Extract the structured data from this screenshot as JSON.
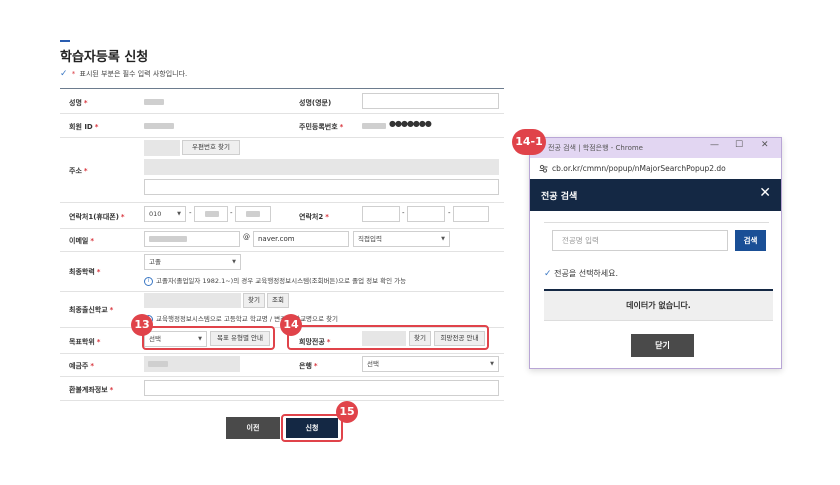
{
  "page": {
    "title": "학습자등록 신청",
    "required_note_prefix": "✓",
    "required_note_star": "*",
    "required_note": "표시된 부분은 필수 입력 사항입니다."
  },
  "form": {
    "name_label": "성명",
    "name_en_label": "성명(영문)",
    "member_id_label": "회원 ID",
    "rrn_label": "주민등록번호",
    "rrn_masked": "●●●●●●●",
    "address_label": "주소",
    "zip_button": "우편번호 찾기",
    "phone1_label": "연락처1(휴대폰)",
    "phone1_prefix": "010",
    "phone2_label": "연락처2",
    "email_label": "이메일",
    "email_at": "@",
    "email_domain": "naver.com",
    "email_direct": "직접입력",
    "education_label": "최종학력",
    "education_value": "고졸",
    "education_info": "고졸자(졸업일자 1982.1~)의 경우 교육행정정보시스템(조회버튼)으로 졸업 정보 확인 가능",
    "school_label": "최종출신학교",
    "school_find": "찾기",
    "school_lookup": "조회",
    "school_info": "교육행정정보시스템으로 고등학교 학교명 / 변경된 학교명으로 찾기",
    "degree_label": "목표학위",
    "degree_select": "선택",
    "degree_guide_button": "목표 유형별 안내",
    "major_label": "희망전공",
    "major_find": "찾기",
    "major_guide_button": "희망전공 안내",
    "depositor_label": "예금주",
    "bank_label": "은행",
    "bank_select": "선택",
    "refund_label": "환불계좌정보",
    "required_star": "*"
  },
  "actions": {
    "prev": "이전",
    "submit": "신청"
  },
  "badges": {
    "b13": "13",
    "b14": "14",
    "b15": "15",
    "b14_1": "14-1"
  },
  "popup": {
    "window_title": "전공 검색 | 학점은행 - Chrome",
    "url": "cb.or.kr/cmmn/popup/nMajorSearchPopup2.do",
    "header": "전공 검색",
    "search_placeholder": "전공명 입력",
    "search_button": "검색",
    "select_prompt": "전공을 선택하세요.",
    "empty_message": "데이터가 없습니다.",
    "close_button": "닫기"
  },
  "colors": {
    "accent_red": "#e0434a",
    "navy": "#142844",
    "search_blue": "#1a4f96",
    "chrome_bar": "#e2d6f2"
  }
}
